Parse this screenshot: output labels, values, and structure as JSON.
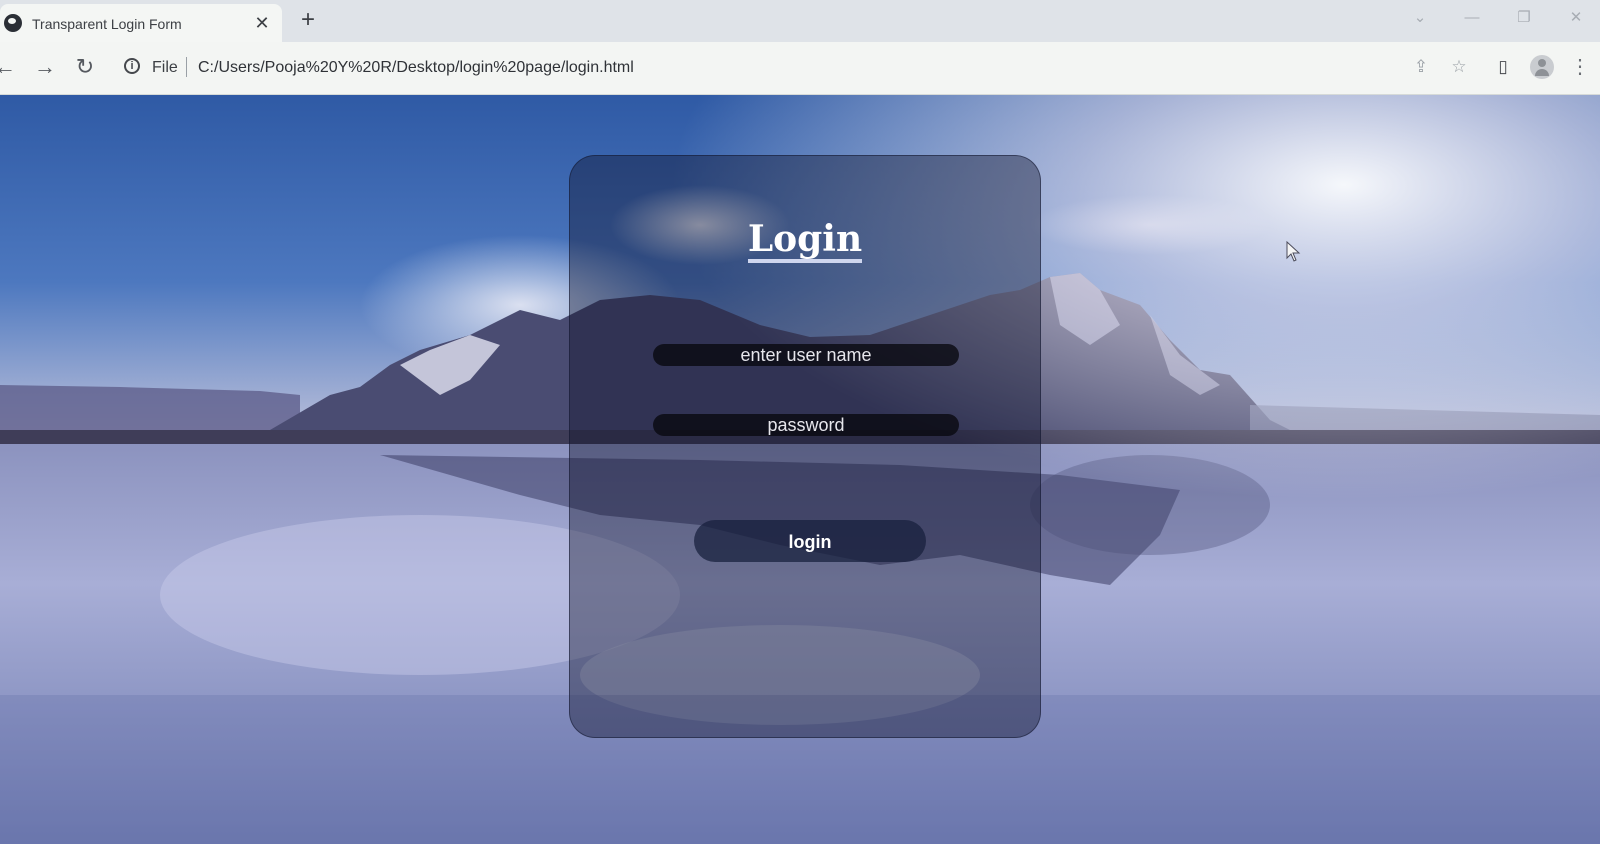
{
  "browser": {
    "tab": {
      "title": "Transparent Login Form",
      "close": "✕"
    },
    "new_tab": "+",
    "nav": {
      "back": "←",
      "forward": "→",
      "reload": "↻"
    },
    "address": {
      "scheme": "File",
      "url": "C:/Users/Pooja%20Y%20R/Desktop/login%20page/login.html"
    },
    "window_controls": {
      "chevron": "⌄",
      "minimize": "—",
      "maximize": "❐",
      "close": "✕"
    },
    "tools": {
      "share": "⇪",
      "bookmark": "☆",
      "sidepanel": "▯",
      "menu": "⋮"
    }
  },
  "page": {
    "title": "Login",
    "username": {
      "value": "",
      "placeholder": "enter user name"
    },
    "password": {
      "value": "",
      "placeholder": "password"
    },
    "login_button": "login"
  },
  "colors": {
    "sky": "#3f6bb0",
    "card": "#0c1028",
    "field": "#08080e"
  }
}
